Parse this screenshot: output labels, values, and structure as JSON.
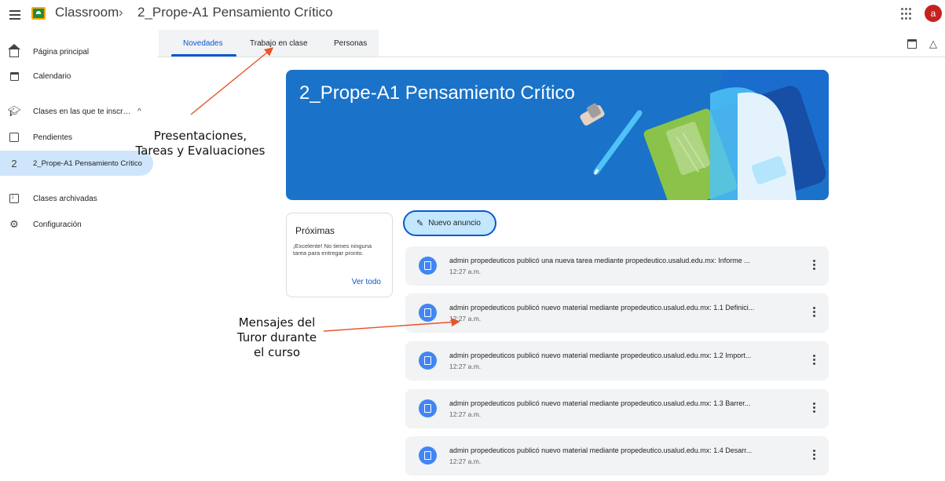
{
  "topbar": {
    "app_name": "Classroom",
    "separator": "›",
    "class_name": "2_Prope-A1 Pensamiento Crítico",
    "avatar_letter": "a"
  },
  "sidebar": {
    "items": [
      {
        "label": "Página principal",
        "icon": "home-icon"
      },
      {
        "label": "Calendario",
        "icon": "calendar-icon"
      },
      {
        "label": "Clases en las que te inscr…",
        "icon": "graduation-cap-icon",
        "expand": "^"
      },
      {
        "label": "Pendientes",
        "icon": "todo-icon"
      },
      {
        "label": "2_Prope-A1 Pensamiento Crítico",
        "icon": "class-number-icon",
        "number": "2"
      },
      {
        "label": "Clases archivadas",
        "icon": "archive-icon"
      },
      {
        "label": "Configuración",
        "icon": "gear-icon"
      }
    ]
  },
  "tabs": [
    {
      "label": "Novedades"
    },
    {
      "label": "Trabajo en clase"
    },
    {
      "label": "Personas"
    }
  ],
  "banner": {
    "title": "2_Prope-A1 Pensamiento Crítico",
    "color": "#1a73c8"
  },
  "upcoming": {
    "title": "Próximas",
    "text": "¡Excelente! No tienes ninguna tarea para entregar pronto.",
    "link": "Ver todo"
  },
  "new_announcement": {
    "label": "Nuevo anuncio"
  },
  "posts": [
    {
      "text": "admin propedeuticos publicó una nueva tarea mediante propedeutico.usalud.edu.mx: Informe ...",
      "time": "12:27 a.m.",
      "icon": "assignment-icon"
    },
    {
      "text": "admin propedeuticos publicó nuevo material mediante propedeutico.usalud.edu.mx: 1.1 Definici...",
      "time": "12:27 a.m.",
      "icon": "material-icon"
    },
    {
      "text": "admin propedeuticos publicó nuevo material mediante propedeutico.usalud.edu.mx: 1.2 Import...",
      "time": "12:27 a.m.",
      "icon": "material-icon"
    },
    {
      "text": "admin propedeuticos publicó nuevo material mediante propedeutico.usalud.edu.mx: 1.3 Barrer...",
      "time": "12:27 a.m.",
      "icon": "material-icon"
    },
    {
      "text": "admin propedeuticos publicó nuevo material mediante propedeutico.usalud.edu.mx: 1.4 Desarr...",
      "time": "12:27 a.m.",
      "icon": "material-icon"
    }
  ],
  "annotations": {
    "work_note_line1": "Presentaciones,",
    "work_note_line2": "Tareas y Evaluaciones",
    "messages_note_line1": "Mensajes del",
    "messages_note_line2": "Turor durante",
    "messages_note_line3": "el curso",
    "arrow_color": "#e8542c"
  }
}
